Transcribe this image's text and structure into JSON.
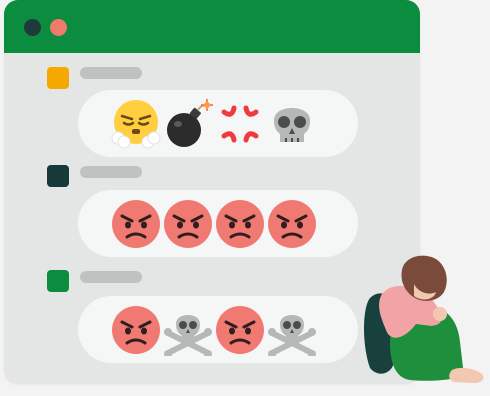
{
  "window": {
    "titlebar_color": "#0b8c3e",
    "controls": [
      {
        "name": "dark-dot",
        "color": "#1f3a3a"
      },
      {
        "name": "coral-dot",
        "color": "#f07a6c"
      }
    ]
  },
  "messages": [
    {
      "avatar_color": "#f5a800",
      "emojis": [
        "face-exhaling-icon",
        "bomb-icon",
        "anger-symbol-icon",
        "skull-icon"
      ]
    },
    {
      "avatar_color": "#163a3a",
      "emojis": [
        "angry-face-icon",
        "angry-face-icon",
        "angry-face-icon",
        "angry-face-icon"
      ]
    },
    {
      "avatar_color": "#0b8c3e",
      "emojis": [
        "angry-face-icon",
        "skull-and-crossbones-icon",
        "angry-face-icon",
        "skull-and-crossbones-icon"
      ]
    }
  ],
  "person": {
    "hair_color": "#7a4a3a",
    "skin_color": "#f2c9b0",
    "sweater_color": "#f1a3a5",
    "pants_color": "#1e8f3c",
    "backpack_color": "#18403c"
  }
}
